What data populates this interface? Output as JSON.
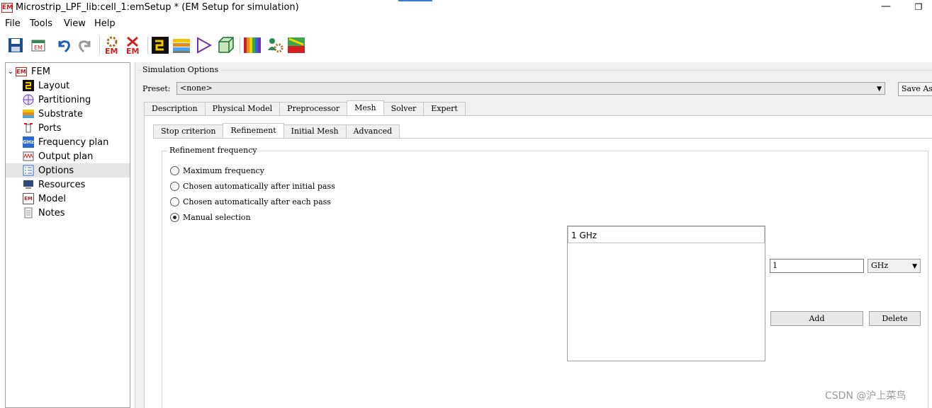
{
  "window": {
    "title": "Microstrip_LPF_lib:cell_1:emSetup * (EM Setup for simulation)",
    "app_icon_text": "EM",
    "minimize_glyph": "—",
    "restore_glyph": "❐"
  },
  "menu": [
    "File",
    "Tools",
    "View",
    "Help"
  ],
  "toolbar": {
    "icons": [
      "save-icon",
      "em-export-icon",
      "undo-icon",
      "redo-icon",
      "em-simulate-icon",
      "em-stop-icon",
      "layout-icon",
      "substrate-icon",
      "triangle-icon",
      "cube-icon",
      "color-bars-icon",
      "gear-person-icon",
      "field-plot-icon"
    ],
    "em_label": "EM"
  },
  "tree": {
    "root": "FEM",
    "items": [
      {
        "label": "Layout",
        "icon": "layout-icon"
      },
      {
        "label": "Partitioning",
        "icon": "partitioning-icon"
      },
      {
        "label": "Substrate",
        "icon": "substrate-icon"
      },
      {
        "label": "Ports",
        "icon": "ports-icon"
      },
      {
        "label": "Frequency plan",
        "icon": "frequency-plan-icon"
      },
      {
        "label": "Output plan",
        "icon": "output-plan-icon"
      },
      {
        "label": "Options",
        "icon": "options-icon"
      },
      {
        "label": "Resources",
        "icon": "resources-icon"
      },
      {
        "label": "Model",
        "icon": "model-icon"
      },
      {
        "label": "Notes",
        "icon": "notes-icon"
      }
    ],
    "selected": "Options"
  },
  "simulation_options": {
    "group_title": "Simulation Options",
    "preset_label": "Preset:",
    "preset_value": "<none>",
    "save_as_label": "Save As",
    "tabs": [
      "Description",
      "Physical Model",
      "Preprocessor",
      "Mesh",
      "Solver",
      "Expert"
    ],
    "active_tab": "Mesh",
    "sub_tabs": [
      "Stop criterion",
      "Refinement",
      "Initial Mesh",
      "Advanced"
    ],
    "active_sub_tab": "Refinement"
  },
  "refinement": {
    "group_title": "Refinement frequency",
    "options": [
      {
        "label": "Maximum frequency",
        "checked": false
      },
      {
        "label": "Chosen automatically after initial pass",
        "checked": false
      },
      {
        "label": "Chosen automatically after each pass",
        "checked": false
      },
      {
        "label": "Manual selection",
        "checked": true
      }
    ],
    "frequency_list": [
      "1 GHz"
    ],
    "input_value": "1",
    "unit": "GHz",
    "add_label": "Add",
    "delete_label": "Delete"
  },
  "watermark": "CSDN @沪上菜鸟"
}
